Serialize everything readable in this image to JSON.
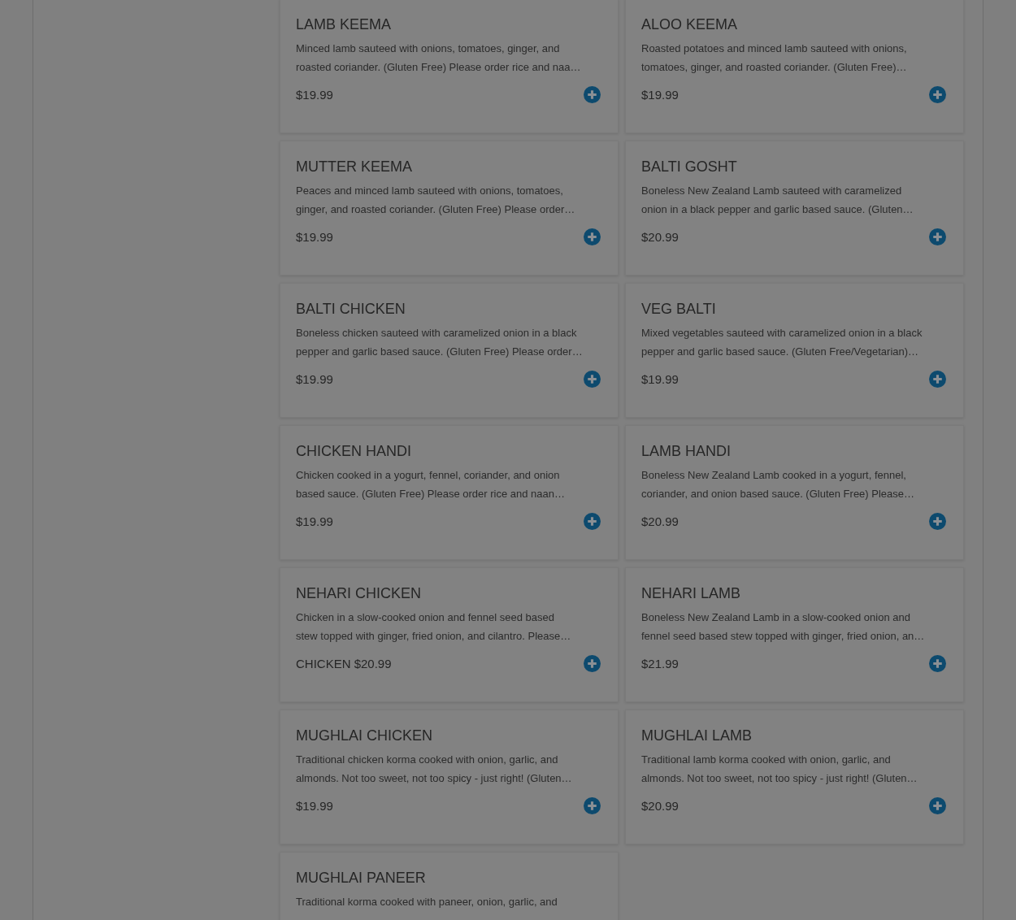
{
  "menu_items": [
    {
      "name": "LAMB KEEMA",
      "description": [
        "Minced lamb sauteed with onions, tomatoes, ginger, and",
        "roasted coriander. (Gluten Free) Please order rice and naa…"
      ],
      "price": "$19.99"
    },
    {
      "name": "ALOO KEEMA",
      "description": [
        "Roasted potatoes and minced lamb sauteed with onions,",
        "tomatoes, ginger, and roasted coriander. (Gluten Free)…"
      ],
      "price": "$19.99"
    },
    {
      "name": "MUTTER KEEMA",
      "description": [
        "Peaces and minced lamb sauteed with onions, tomatoes,",
        "ginger, and roasted coriander. (Gluten Free) Please order…"
      ],
      "price": "$19.99"
    },
    {
      "name": "BALTI GOSHT",
      "description": [
        "Boneless New Zealand Lamb sauteed with caramelized",
        "onion in a black pepper and garlic based sauce. (Gluten…"
      ],
      "price": "$20.99"
    },
    {
      "name": "BALTI CHICKEN",
      "description": [
        "Boneless chicken sauteed with caramelized onion in a black",
        "pepper and garlic based sauce. (Gluten Free) Please order…"
      ],
      "price": "$19.99"
    },
    {
      "name": "VEG BALTI",
      "description": [
        "Mixed vegetables sauteed with caramelized onion in a black",
        "pepper and garlic based sauce. (Gluten Free/Vegetarian)…"
      ],
      "price": "$19.99"
    },
    {
      "name": "CHICKEN HANDI",
      "description": [
        "Chicken cooked in a yogurt, fennel, coriander, and onion",
        "based sauce. (Gluten Free) Please order rice and naan…"
      ],
      "price": "$19.99"
    },
    {
      "name": "LAMB HANDI",
      "description": [
        "Boneless New Zealand Lamb cooked in a yogurt, fennel,",
        "coriander, and onion based sauce. (Gluten Free) Please…"
      ],
      "price": "$20.99"
    },
    {
      "name": "NEHARI CHICKEN",
      "description": [
        "Chicken in a slow-cooked onion and fennel seed based",
        "stew topped with ginger, fried onion, and cilantro. Please…"
      ],
      "price": "CHICKEN $20.99"
    },
    {
      "name": "NEHARI LAMB",
      "description": [
        "Boneless New Zealand Lamb in a slow-cooked onion and",
        "fennel seed based stew topped with ginger, fried onion, an…"
      ],
      "price": "$21.99"
    },
    {
      "name": "MUGHLAI CHICKEN",
      "description": [
        "Traditional chicken korma cooked with onion, garlic, and",
        "almonds. Not too sweet, not too spicy - just right! (Gluten…"
      ],
      "price": "$19.99"
    },
    {
      "name": "MUGHLAI LAMB",
      "description": [
        "Traditional lamb korma cooked with onion, garlic, and",
        "almonds. Not too sweet, not too spicy - just right! (Gluten…"
      ],
      "price": "$20.99"
    },
    {
      "name": "MUGHLAI PANEER",
      "description": [
        "Traditional korma cooked with paneer, onion, garlic, and"
      ]
    }
  ]
}
